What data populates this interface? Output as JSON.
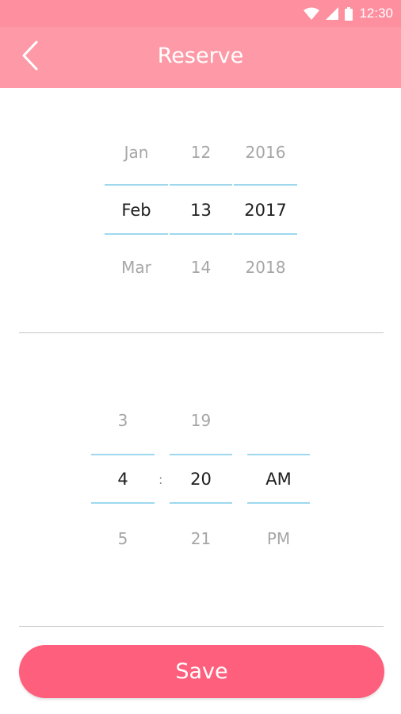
{
  "status_bar": {
    "time": "12:30"
  },
  "header": {
    "title": "Reserve"
  },
  "date_picker": {
    "month": {
      "prev": "Jan",
      "selected": "Feb",
      "next": "Mar"
    },
    "day": {
      "prev": "12",
      "selected": "13",
      "next": "14"
    },
    "year": {
      "prev": "2016",
      "selected": "2017",
      "next": "2018"
    }
  },
  "time_picker": {
    "hour": {
      "prev": "3",
      "selected": "4",
      "next": "5"
    },
    "separator": ":",
    "minute": {
      "prev": "19",
      "selected": "20",
      "next": "21"
    },
    "ampm": {
      "selected": "AM",
      "next": "PM"
    }
  },
  "actions": {
    "save_label": "Save"
  },
  "colors": {
    "status_bar": "#fd8f9f",
    "app_bar": "#fe9aa7",
    "accent_button": "#fe5f7d",
    "picker_line": "#9fd8ee"
  }
}
